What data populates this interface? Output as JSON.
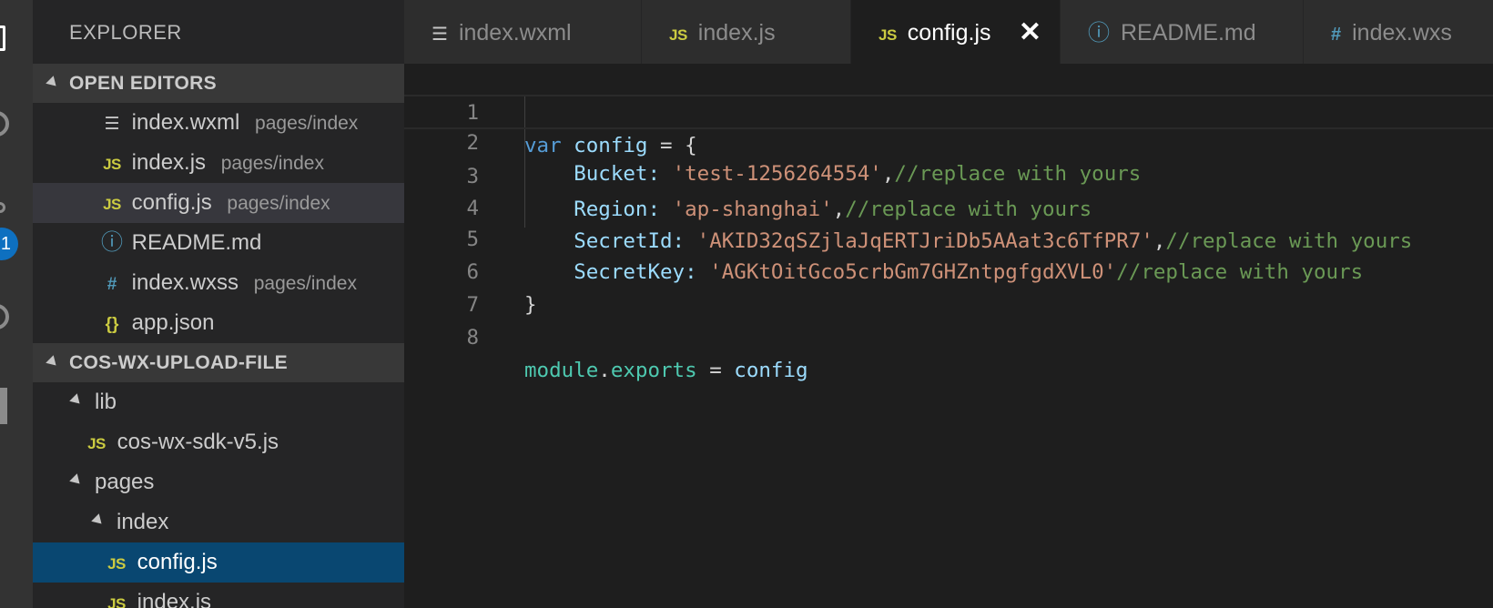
{
  "explorer": {
    "title": "EXPLORER",
    "open_editors": {
      "header": "OPEN EDITORS",
      "items": [
        {
          "name": "index.wxml",
          "path": "pages/index",
          "icon": "lines-icon"
        },
        {
          "name": "index.js",
          "path": "pages/index",
          "icon": "js-icon"
        },
        {
          "name": "config.js",
          "path": "pages/index",
          "icon": "js-icon"
        },
        {
          "name": "README.md",
          "path": "",
          "icon": "info-icon"
        },
        {
          "name": "index.wxss",
          "path": "pages/index",
          "icon": "hash-icon"
        },
        {
          "name": "app.json",
          "path": "",
          "icon": "braces-icon"
        }
      ]
    },
    "project": {
      "header": "COS-WX-UPLOAD-FILE",
      "tree": [
        {
          "label": "lib",
          "type": "folder"
        },
        {
          "label": "cos-wx-sdk-v5.js",
          "type": "file",
          "icon": "js-icon"
        },
        {
          "label": "pages",
          "type": "folder"
        },
        {
          "label": "index",
          "type": "folder"
        },
        {
          "label": "config.js",
          "type": "file",
          "icon": "js-icon"
        },
        {
          "label": "index.js",
          "type": "file",
          "icon": "js-icon"
        }
      ]
    }
  },
  "activity_bar": {
    "icons": [
      "files-icon",
      "search-icon",
      "source-control-icon",
      "debug-icon",
      "extensions-icon"
    ],
    "badge": "1"
  },
  "tabs": [
    {
      "label": "index.wxml",
      "icon": "lines-icon",
      "active": false
    },
    {
      "label": "index.js",
      "icon": "js-icon",
      "active": false
    },
    {
      "label": "config.js",
      "icon": "js-icon",
      "active": true,
      "close": "✕"
    },
    {
      "label": "README.md",
      "icon": "info-icon",
      "active": false
    },
    {
      "label": "index.wxs",
      "icon": "hash-icon",
      "active": false
    }
  ],
  "editor": {
    "line_numbers": [
      "1",
      "2",
      "3",
      "4",
      "5",
      "6",
      "7",
      "8"
    ],
    "code": {
      "l1": {
        "kw": "var",
        "name": " config",
        "rest": " = {"
      },
      "l2": {
        "key": "Bucket:",
        "val": "'test-1256264554'",
        "sep": ",",
        "cmt": "//replace with yours"
      },
      "l3": {
        "key": "Region:",
        "val": "'ap-shanghai'",
        "sep": ",",
        "cmt": "//replace with yours"
      },
      "l4": {
        "key": "SecretId:",
        "val": "'AKID32qSZjlaJqERTJriDb5AAat3c6TfPR7'",
        "sep": ",",
        "cmt": "//replace with yours"
      },
      "l5": {
        "key": "SecretKey:",
        "val": "'AGKtOitGco5crbGm7GHZntpgfgdXVL0'",
        "sep": "",
        "cmt": "//replace with yours"
      },
      "l6": {
        "text": "}"
      },
      "l8": {
        "obj": "module",
        "dot": ".",
        "prop": "exports",
        "eq": " = ",
        "val": "config"
      }
    }
  },
  "colors": {
    "accent": "#0e70c0",
    "selection": "#094771",
    "keyword": "#569cd6",
    "string": "#ce9178",
    "comment": "#6a9955",
    "js_icon": "#cbcb41"
  }
}
